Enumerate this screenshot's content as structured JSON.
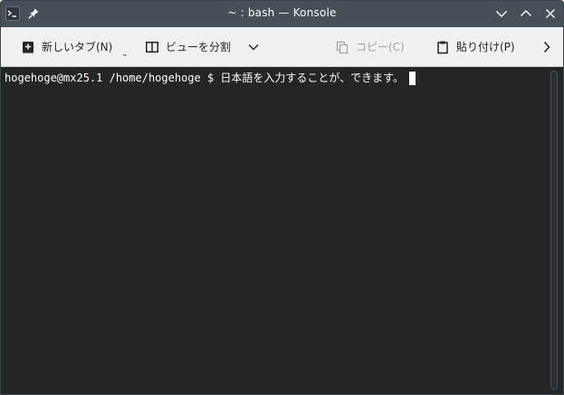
{
  "window": {
    "title": "~ : bash — Konsole"
  },
  "titlebar": {
    "app_icon": "konsole-app-icon",
    "pin_icon": "pin-icon",
    "buttons": [
      "chevron-down-icon",
      "chevron-up-icon",
      "close-icon"
    ]
  },
  "toolbar": {
    "new_tab_label": "新しいタブ(N)",
    "split_view_label": "ビューを分割",
    "copy_label": "コピー(C)",
    "paste_label": "貼り付け(P)",
    "copy_enabled": false
  },
  "terminal": {
    "prompt": "hogehoge@mx25.1 /home/hogehoge $ ",
    "input": "日本語を入力することが、できます。"
  },
  "colors": {
    "titlebar_bg": "#475057",
    "toolbar_bg": "#eff0f1",
    "terminal_bg": "#232627",
    "terminal_fg": "#fcfcfc"
  }
}
